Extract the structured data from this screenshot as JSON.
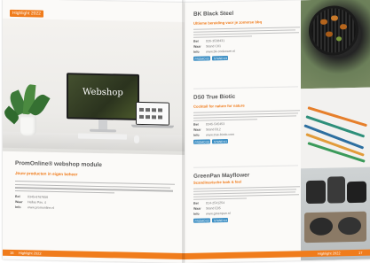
{
  "left_page": {
    "tag": "Highlight 2022",
    "screen_text": "Webshop",
    "title": "PromOnline® webshop module",
    "subtitle": "Jouw producten in eigen beheer",
    "details": [
      {
        "key": "Bel",
        "value": "0345-6767656"
      },
      {
        "key": "Waar",
        "value": "Hellas Pav. 4"
      },
      {
        "key": "Info",
        "value": "www.promonline.nl"
      }
    ],
    "footer_page_number": "16",
    "footer_label": "Highlight 2022"
  },
  "right_page": {
    "articles": [
      {
        "title": "BK Black Steel",
        "subtitle": "Ultieme bereiding voor je zomerse bbq",
        "details": [
          {
            "key": "Bel",
            "value": "026-3538431"
          },
          {
            "key": "Waar",
            "value": "Stand C01"
          },
          {
            "key": "Info",
            "value": "www.bk-cookware.nl"
          }
        ],
        "pills": [
          "PROMO 05",
          "STAND 03"
        ]
      },
      {
        "title": "DS0 True Biotic",
        "subtitle": "Cocktail for nature for nature",
        "details": [
          {
            "key": "Bel",
            "value": "0345-545453"
          },
          {
            "key": "Waar",
            "value": "Stand B12"
          },
          {
            "key": "Info",
            "value": "www.true-biotic.com"
          }
        ],
        "pills": [
          "PROMO 08",
          "STAND 01"
        ]
      },
      {
        "title": "GreenPan Mayflower",
        "subtitle": "Scandinavische look & feel",
        "details": [
          {
            "key": "Bel",
            "value": "014-2541254"
          },
          {
            "key": "Waar",
            "value": "Stand E05"
          },
          {
            "key": "Info",
            "value": "www.greenpan.nl"
          }
        ],
        "pills": [
          "PROMO 02",
          "STAND 04"
        ]
      }
    ],
    "footer_label": "Highlight 2022",
    "footer_page_number": "17"
  },
  "colors": {
    "accent": "#f07c1c",
    "title_gray": "#5a5a5a",
    "pill_blue": "#3d8fc4"
  }
}
